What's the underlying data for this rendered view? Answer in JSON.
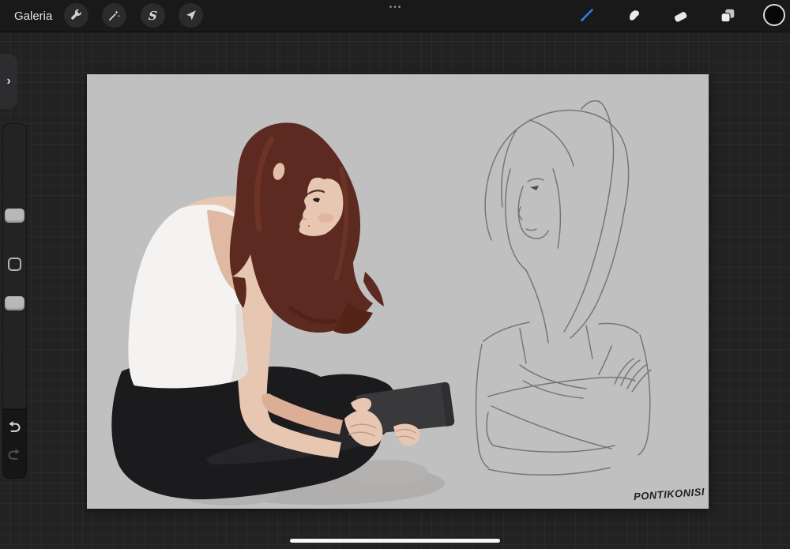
{
  "topbar": {
    "gallery_label": "Galeria",
    "menu_dots_label": "•••",
    "left_tools": [
      {
        "name": "actions",
        "icon": "wrench-icon"
      },
      {
        "name": "adjustments",
        "icon": "magic-wand-icon"
      },
      {
        "name": "selection",
        "icon": "selection-s-icon",
        "glyph": "S"
      },
      {
        "name": "transform",
        "icon": "transform-arrow-icon"
      }
    ],
    "right_tools": [
      {
        "name": "paint",
        "icon": "brush-icon",
        "active": true
      },
      {
        "name": "smudge",
        "icon": "smudge-icon"
      },
      {
        "name": "erase",
        "icon": "eraser-icon"
      },
      {
        "name": "layers",
        "icon": "layers-icon"
      },
      {
        "name": "color",
        "icon": "color-circle-icon",
        "current_color": "#070708"
      }
    ]
  },
  "sidebar": {
    "tab_chevron": "›",
    "controls": [
      "brush-size-slider",
      "modify-button",
      "opacity-slider",
      "undo-button",
      "redo-button"
    ]
  },
  "canvas": {
    "signature": "PONTIKONISI",
    "background_color": "#c1c0c0"
  },
  "colors": {
    "accent_blue": "#2f7fe8",
    "ui_bar": "#19191a",
    "workspace_bg": "#222223",
    "hair": "#5c2a21",
    "skin": "#e8c7b2",
    "tank_top": "#f4f3f1",
    "pants": "#1b1b1d",
    "tablet": "#39393c",
    "sketch_line": "#6f6f6f"
  }
}
